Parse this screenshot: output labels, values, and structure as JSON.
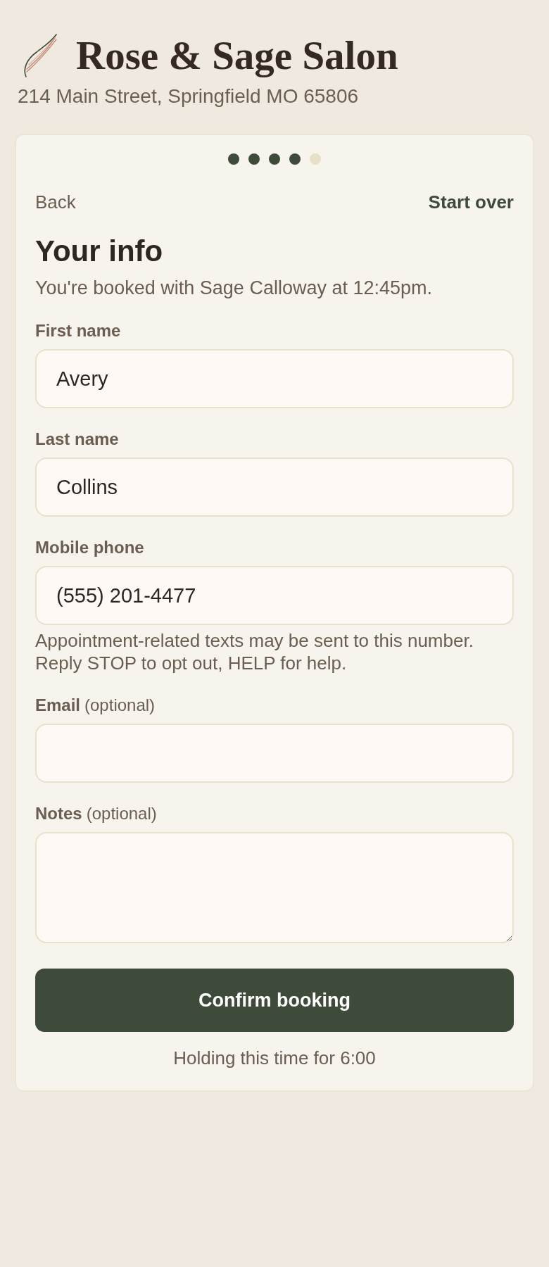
{
  "header": {
    "title": "Rose & Sage Salon",
    "address": "214 Main Street, Springfield MO 65806"
  },
  "progress": [
    {
      "done": true
    },
    {
      "done": true
    },
    {
      "done": true
    },
    {
      "done": true
    },
    {
      "done": false
    }
  ],
  "nav": {
    "back": "Back",
    "start_over": "Start over"
  },
  "heading": "Your info",
  "summary": "You're booked with Sage Calloway at 12:45pm.",
  "fields": [
    {
      "kind": "input",
      "label": "First name",
      "value": "Avery"
    },
    {
      "kind": "input",
      "label": "Last name",
      "value": "Collins"
    },
    {
      "kind": "input",
      "label": "Mobile phone",
      "value": "(555) 201-4477",
      "hint": "Appointment-related texts may be sent to this number. Reply STOP to opt out, HELP for help."
    },
    {
      "kind": "input",
      "label": "Email",
      "note": "(optional)"
    },
    {
      "kind": "textarea",
      "label": "Notes",
      "note": "(optional)"
    }
  ],
  "confirm_button": "Confirm booking",
  "hold_notice": "Holding this time for 6:00"
}
